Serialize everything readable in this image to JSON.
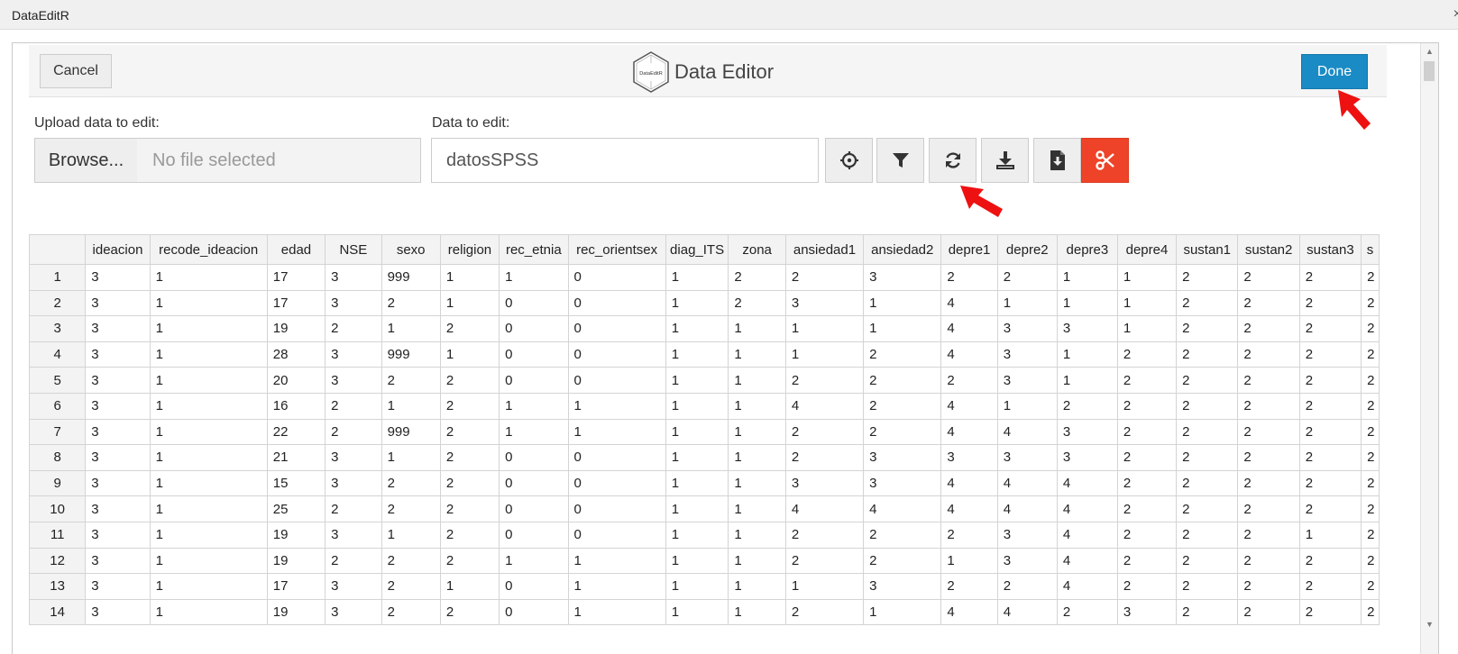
{
  "window": {
    "title": "DataEditR",
    "close_glyph": "×"
  },
  "header": {
    "cancel_label": "Cancel",
    "logo_text": "DataEditR",
    "title": "Data Editor",
    "done_label": "Done"
  },
  "upload": {
    "label": "Upload data to edit:",
    "browse_label": "Browse...",
    "file_status": "No file selected"
  },
  "data_select": {
    "label": "Data to edit:",
    "value": "datosSPSS"
  },
  "toolbar": {
    "icons": [
      "crosshairs-icon",
      "filter-icon",
      "sync-icon",
      "download-icon",
      "file-download-icon",
      "scissors-icon"
    ],
    "danger_color": "#ee4328"
  },
  "accent_color": "#1a8bc4",
  "table": {
    "columns": [
      "ideacion",
      "recode_ideacion",
      "edad",
      "NSE",
      "sexo",
      "religion",
      "rec_etnia",
      "rec_orientsex",
      "diag_ITS",
      "zona",
      "ansiedad1",
      "ansiedad2",
      "depre1",
      "depre2",
      "depre3",
      "depre4",
      "sustan1",
      "sustan2",
      "sustan3",
      "s"
    ],
    "rows": [
      [
        "1",
        "3",
        "1",
        "17",
        "3",
        "999",
        "1",
        "1",
        "0",
        "1",
        "2",
        "2",
        "3",
        "2",
        "2",
        "1",
        "1",
        "2",
        "2",
        "2",
        "2"
      ],
      [
        "2",
        "3",
        "1",
        "17",
        "3",
        "2",
        "1",
        "0",
        "0",
        "1",
        "2",
        "3",
        "1",
        "4",
        "1",
        "1",
        "1",
        "2",
        "2",
        "2",
        "2"
      ],
      [
        "3",
        "3",
        "1",
        "19",
        "2",
        "1",
        "2",
        "0",
        "0",
        "1",
        "1",
        "1",
        "1",
        "4",
        "3",
        "3",
        "1",
        "2",
        "2",
        "2",
        "2"
      ],
      [
        "4",
        "3",
        "1",
        "28",
        "3",
        "999",
        "1",
        "0",
        "0",
        "1",
        "1",
        "1",
        "2",
        "4",
        "3",
        "1",
        "2",
        "2",
        "2",
        "2",
        "2"
      ],
      [
        "5",
        "3",
        "1",
        "20",
        "3",
        "2",
        "2",
        "0",
        "0",
        "1",
        "1",
        "2",
        "2",
        "2",
        "3",
        "1",
        "2",
        "2",
        "2",
        "2",
        "2"
      ],
      [
        "6",
        "3",
        "1",
        "16",
        "2",
        "1",
        "2",
        "1",
        "1",
        "1",
        "1",
        "4",
        "2",
        "4",
        "1",
        "2",
        "2",
        "2",
        "2",
        "2",
        "2"
      ],
      [
        "7",
        "3",
        "1",
        "22",
        "2",
        "999",
        "2",
        "1",
        "1",
        "1",
        "1",
        "2",
        "2",
        "4",
        "4",
        "3",
        "2",
        "2",
        "2",
        "2",
        "2"
      ],
      [
        "8",
        "3",
        "1",
        "21",
        "3",
        "1",
        "2",
        "0",
        "0",
        "1",
        "1",
        "2",
        "3",
        "3",
        "3",
        "3",
        "2",
        "2",
        "2",
        "2",
        "2"
      ],
      [
        "9",
        "3",
        "1",
        "15",
        "3",
        "2",
        "2",
        "0",
        "0",
        "1",
        "1",
        "3",
        "3",
        "4",
        "4",
        "4",
        "2",
        "2",
        "2",
        "2",
        "2"
      ],
      [
        "10",
        "3",
        "1",
        "25",
        "2",
        "2",
        "2",
        "0",
        "0",
        "1",
        "1",
        "4",
        "4",
        "4",
        "4",
        "4",
        "2",
        "2",
        "2",
        "2",
        "2"
      ],
      [
        "11",
        "3",
        "1",
        "19",
        "3",
        "1",
        "2",
        "0",
        "0",
        "1",
        "1",
        "2",
        "2",
        "2",
        "3",
        "4",
        "2",
        "2",
        "2",
        "1",
        "2"
      ],
      [
        "12",
        "3",
        "1",
        "19",
        "2",
        "2",
        "2",
        "1",
        "1",
        "1",
        "1",
        "2",
        "2",
        "1",
        "3",
        "4",
        "2",
        "2",
        "2",
        "2",
        "2"
      ],
      [
        "13",
        "3",
        "1",
        "17",
        "3",
        "2",
        "1",
        "0",
        "1",
        "1",
        "1",
        "1",
        "3",
        "2",
        "2",
        "4",
        "2",
        "2",
        "2",
        "2",
        "2"
      ],
      [
        "14",
        "3",
        "1",
        "19",
        "3",
        "2",
        "2",
        "0",
        "1",
        "1",
        "1",
        "2",
        "1",
        "4",
        "4",
        "2",
        "3",
        "2",
        "2",
        "2",
        "2"
      ]
    ]
  }
}
